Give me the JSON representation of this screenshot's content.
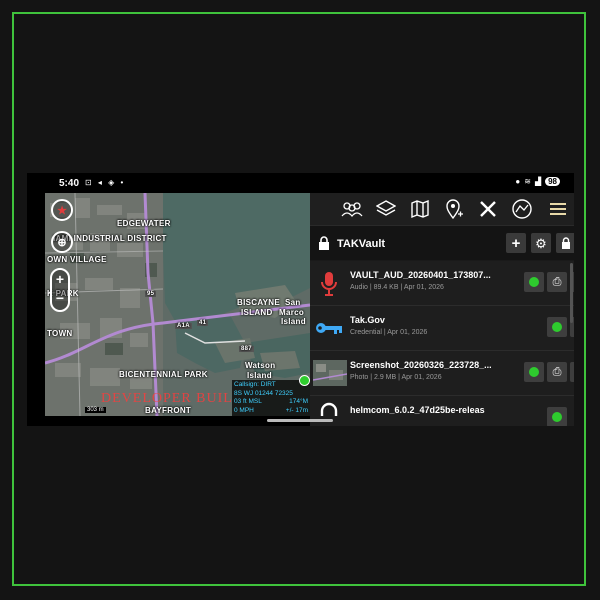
{
  "status_bar": {
    "time": "5:40",
    "left_icons": "⊡ ◂ ◈ •",
    "battery": "98"
  },
  "map": {
    "labels": {
      "edgewater": "EDGEWATER",
      "industrial": "IAMI INDUSTRIAL DISTRICT",
      "village": "OWN VILLAGE",
      "park": "K PARK",
      "biscayne": "BISCAYNE",
      "island": "ISLAND",
      "isla": "San",
      "marco": "Marco",
      "island2": "Island",
      "downtown": "TOWN",
      "watson": "Watson",
      "island3": "Island",
      "bicentennial": "BICENTENNIAL PARK",
      "bayfront": "BAYFRONT",
      "hwy_a1a": "A1A",
      "hwy_41": "41",
      "hwy_887": "887",
      "hwy_95": "95"
    },
    "zoom_in": "+",
    "zoom_out": "−",
    "scale": "303 m",
    "dev_build": "DEVELOPER BUIL",
    "info": {
      "callsign": "Callsign: DIRT",
      "grid": "8S WJ 01244 72325",
      "alt": "03 ft MSL",
      "heading": "174°M",
      "speed": "0 MPH",
      "accuracy": "+/- 17m"
    }
  },
  "panel": {
    "title": "TAKVault",
    "items": [
      {
        "name": "VAULT_AUD_20260401_173807...",
        "meta": "Audio | 89.4 KB | Apr 01, 2026",
        "type": "audio"
      },
      {
        "name": "Tak.Gov",
        "meta": "Credential | Apr 01, 2026",
        "type": "credential"
      },
      {
        "name": "Screenshot_20260326_223728_...",
        "meta": "Photo | 2.9 MB | Apr 01, 2026",
        "type": "photo"
      },
      {
        "name": "helmcom_6.0.2_47d25be-releas",
        "meta": "",
        "type": "file"
      }
    ]
  },
  "colors": {
    "accent_green": "#2ecc2e",
    "frame_green": "#3fc23c",
    "mic_red": "#e03c3c",
    "key_blue": "#3fa9f5"
  }
}
